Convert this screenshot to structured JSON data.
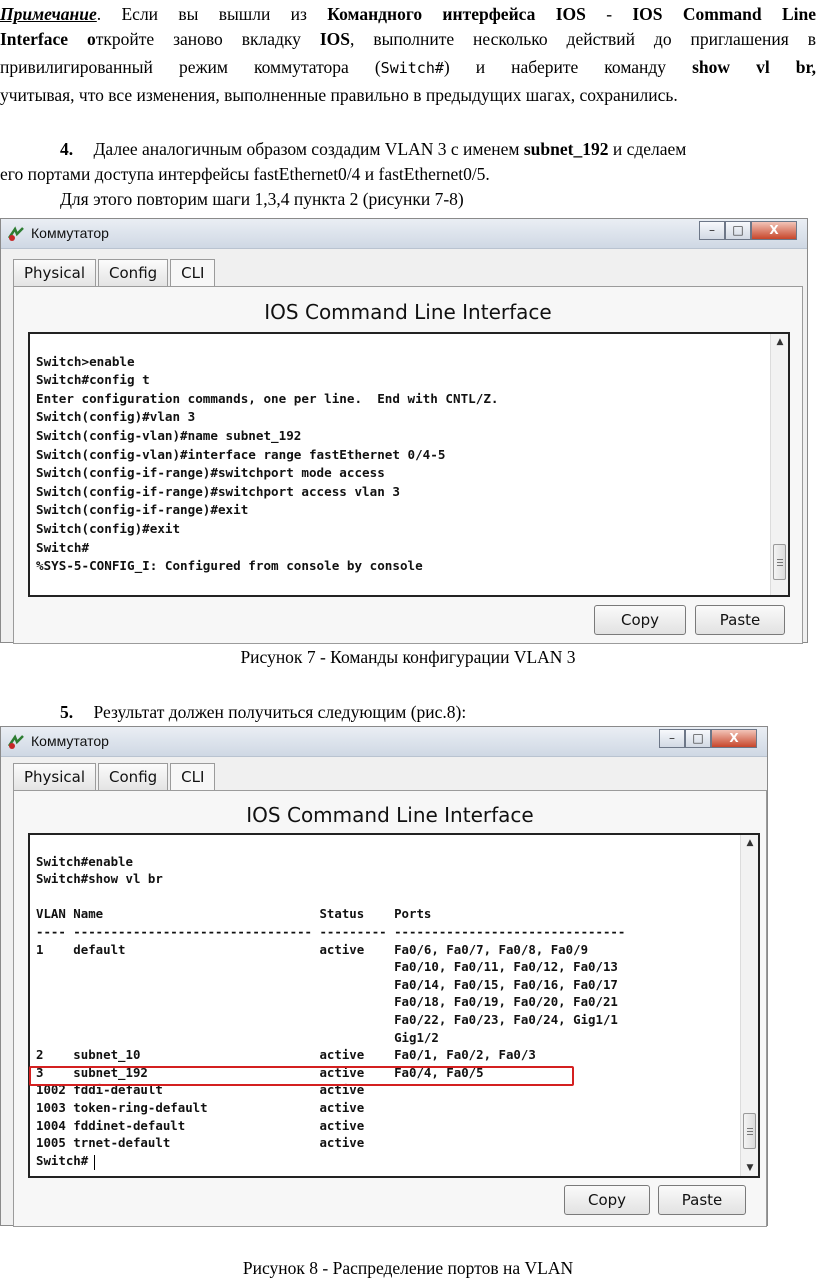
{
  "note": {
    "label": "Примечание",
    "l1_a": ". Если вы вышли из ",
    "l1_b": "Командного интерфейса IOS",
    "l1_c": " - ",
    "l1_d": "IOS Command Line",
    "l2_a": "Interface",
    "l2_b": " о",
    "l2_c": "ткройте заново вкладку ",
    "l2_d": "IOS",
    "l2_e": ", выполните несколько действий до приглашения в",
    "l3_a": "привилигированный режим коммутатора (",
    "l3_b": "Switch#",
    "l3_c": ") и наберите команду ",
    "l3_d": "show vl br,",
    "l4": "учитывая, что все изменения, выполненные правильно в предыдущих шагах, сохранились."
  },
  "step4": {
    "num": "4.",
    "l1_a": "Далее аналогичным образом создадим VLAN 3 с именем ",
    "l1_b": "subnet_192",
    "l1_c": " и сделаем",
    "l2": "его портами доступа интерфейсы fastEthernet0/4 и fastEthernet0/5.",
    "l3": "Для этого повторим шаги 1,3,4 пункта 2 (рисунки 7-8)"
  },
  "step5": {
    "num": "5.",
    "text": "Результат должен получиться следующим (рис.8):"
  },
  "window": {
    "title": "Коммутатор",
    "tabs": [
      "Physical",
      "Config",
      "CLI"
    ],
    "cli_title": "IOS Command Line Interface",
    "copy": "Copy",
    "paste": "Paste",
    "minimize": "–",
    "maximize": "□",
    "close": "X"
  },
  "fig7": {
    "console": "\nSwitch>enable\nSwitch#config t\nEnter configuration commands, one per line.  End with CNTL/Z.\nSwitch(config)#vlan 3\nSwitch(config-vlan)#name subnet_192\nSwitch(config-vlan)#interface range fastEthernet 0/4-5\nSwitch(config-if-range)#switchport mode access\nSwitch(config-if-range)#switchport access vlan 3\nSwitch(config-if-range)#exit\nSwitch(config)#exit\nSwitch#\n%SYS-5-CONFIG_I: Configured from console by console",
    "caption": "Рисунок 7 - Команды конфигурации VLAN 3"
  },
  "fig8": {
    "console": "\nSwitch#enable\nSwitch#show vl br\n\nVLAN Name                             Status    Ports\n---- -------------------------------- --------- -------------------------------\n1    default                          active    Fa0/6, Fa0/7, Fa0/8, Fa0/9\n                                                Fa0/10, Fa0/11, Fa0/12, Fa0/13\n                                                Fa0/14, Fa0/15, Fa0/16, Fa0/17\n                                                Fa0/18, Fa0/19, Fa0/20, Fa0/21\n                                                Fa0/22, Fa0/23, Fa0/24, Gig1/1\n                                                Gig1/2\n2    subnet_10                        active    Fa0/1, Fa0/2, Fa0/3\n3    subnet_192                       active    Fa0/4, Fa0/5\n1002 fddi-default                     active\n1003 token-ring-default               active\n1004 fddinet-default                  active\n1005 trnet-default                    active\nSwitch#",
    "caption": "Рисунок 8 - Распределение портов на VLAN"
  },
  "colors": {
    "highlight": "#d42020",
    "titlebar": "#cfd8e4",
    "close_button": "#c7462b"
  }
}
